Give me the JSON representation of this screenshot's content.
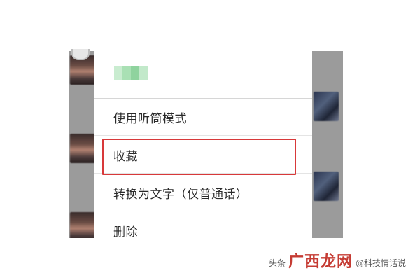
{
  "menu": {
    "sender_name": "",
    "items": [
      {
        "label": "使用听筒模式"
      },
      {
        "label": "收藏"
      },
      {
        "label": "转换为文字（仅普通话）"
      },
      {
        "label": "删除"
      }
    ],
    "highlighted_index": 1
  },
  "watermark": {
    "left_text": "头条",
    "main_text": "广西龙网",
    "right_text": "@科技情话说",
    "main_color": "#c53b33"
  },
  "colors": {
    "highlight_border": "#d8393a",
    "dim_background": "#9b9b9b"
  },
  "icons": {
    "pixelated_name": "pixelated-name-icon",
    "corner": "headset-icon"
  }
}
